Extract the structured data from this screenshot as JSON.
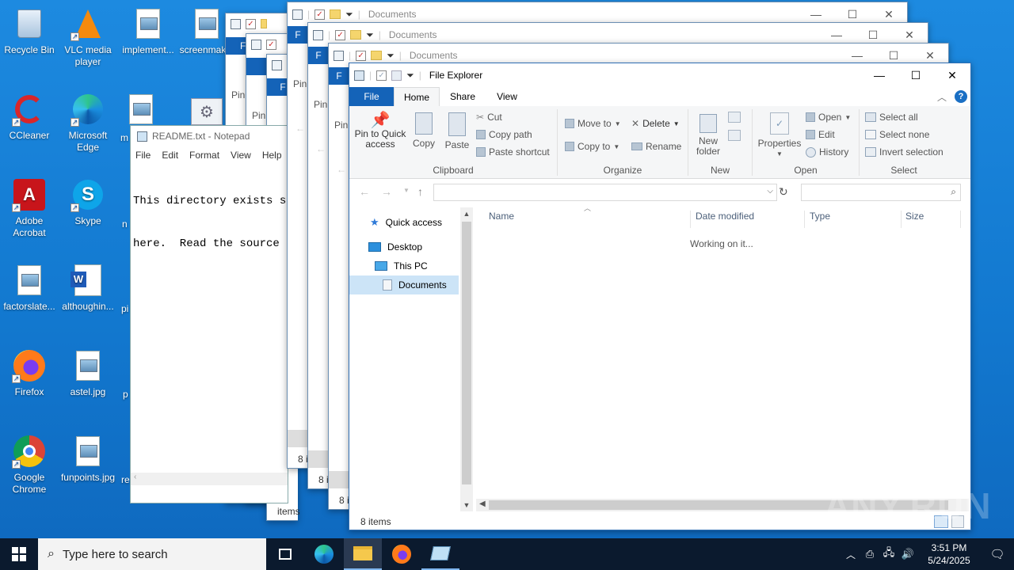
{
  "desktop": {
    "icons": [
      {
        "label": "Recycle Bin"
      },
      {
        "label": "VLC media player"
      },
      {
        "label": "implement..."
      },
      {
        "label": "screenmak..."
      },
      {
        "label": "CCleaner"
      },
      {
        "label": "Microsoft Edge"
      },
      {
        "label": "m"
      },
      {
        "label": "Adobe Acrobat"
      },
      {
        "label": "Skype"
      },
      {
        "label": "n"
      },
      {
        "label": "factorslate..."
      },
      {
        "label": "althoughin..."
      },
      {
        "label": "pi"
      },
      {
        "label": "Firefox"
      },
      {
        "label": "astel.jpg"
      },
      {
        "label": "p"
      },
      {
        "label": "Google Chrome"
      },
      {
        "label": "funpoints.jpg"
      },
      {
        "label": "re"
      }
    ]
  },
  "notepad": {
    "title": "README.txt - Notepad",
    "menu": [
      "File",
      "Edit",
      "Format",
      "View",
      "Help"
    ],
    "lines": [
      "This directory exists so",
      "here.  Read the source fi"
    ]
  },
  "background_windows": {
    "title": "Documents",
    "tab_letter": "F",
    "pin_label": "Pin",
    "pin_label_partial": "Pin",
    "status_partial": "8 i",
    "status_full": "8 items"
  },
  "explorer": {
    "title": "File Explorer",
    "tabs": [
      "File",
      "Home",
      "Share",
      "View"
    ],
    "clipboard": {
      "pin": "Pin to Quick access",
      "copy": "Copy",
      "paste": "Paste",
      "cut": "Cut",
      "copy_path": "Copy path",
      "paste_shortcut": "Paste shortcut",
      "group": "Clipboard"
    },
    "organize": {
      "move_to": "Move to",
      "copy_to": "Copy to",
      "delete": "Delete",
      "rename": "Rename",
      "group": "Organize"
    },
    "new": {
      "new_folder": "New folder",
      "group": "New"
    },
    "open": {
      "properties": "Properties",
      "open": "Open",
      "edit": "Edit",
      "history": "History",
      "group": "Open"
    },
    "select": {
      "select_all": "Select all",
      "select_none": "Select none",
      "invert": "Invert selection",
      "group": "Select"
    },
    "nav": {
      "quick_access": "Quick access",
      "desktop": "Desktop",
      "this_pc": "This PC",
      "documents": "Documents"
    },
    "columns": [
      "Name",
      "Date modified",
      "Type",
      "Size"
    ],
    "working": "Working on it...",
    "status": "8 items"
  },
  "taskbar": {
    "search_placeholder": "Type here to search",
    "time": "3:51 PM",
    "date": "5/24/2025"
  },
  "watermark": "ANY.RUN"
}
